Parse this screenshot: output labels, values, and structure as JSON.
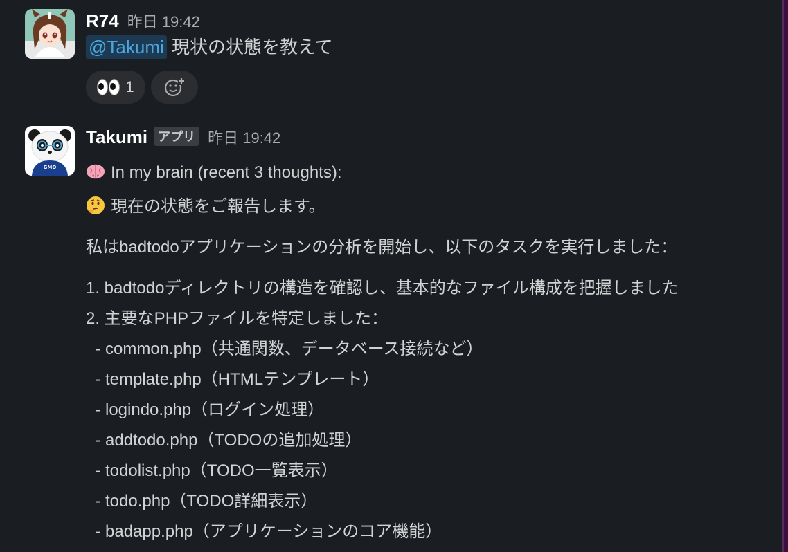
{
  "messages": [
    {
      "username": "R74",
      "timestamp": "昨日 19:42",
      "mention": "@Takumi",
      "text": " 現状の状態を教えて",
      "reactions": [
        {
          "emoji": "eyes-emoji",
          "count": "1"
        },
        {
          "emoji": "add-reaction-icon"
        }
      ]
    },
    {
      "username": "Takumi",
      "badge": "アプリ",
      "timestamp": "昨日 19:42",
      "brain_line": "In my brain (recent 3 thoughts):",
      "think_line": "現在の状態をご報告します。",
      "intro": "私はbadtodoアプリケーションの分析を開始し、以下のタスクを実行しました：",
      "list": [
        "1. badtodoディレクトリの構造を確認し、基本的なファイル構成を把握しました",
        "2. 主要なPHPファイルを特定しました：",
        "  - common.php（共通関数、データベース接続など）",
        "  - template.php（HTMLテンプレート）",
        "  - logindo.php（ログイン処理）",
        "  - addtodo.php（TODOの追加処理）",
        "  - todolist.php（TODO一覧表示）",
        "  - todo.php（TODO詳細表示）",
        "  - badapp.php（アプリケーションのコア機能）"
      ]
    }
  ],
  "avatar_panda_text": "GMO",
  "colors": {
    "background": "#1a1d21",
    "mention_text": "#4aa7dd",
    "mention_bg": "#1d3a52",
    "sidebar_edge": "#3f0e40"
  }
}
